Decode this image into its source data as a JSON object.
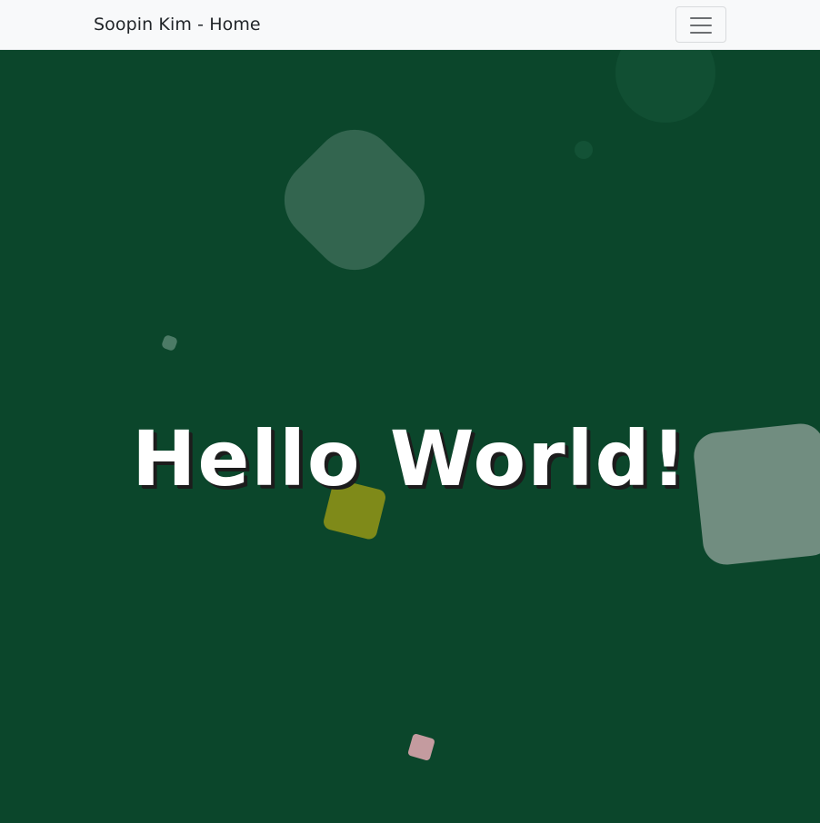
{
  "navbar": {
    "brand": "Soopin Kim - Home",
    "toggler_icon": "hamburger-menu-icon"
  },
  "hero": {
    "headline": "Hello World!",
    "background_color": "#0b462b",
    "shape_colors": {
      "large_blob": "#33654f",
      "right_square": "#718d80",
      "olive_square": "#7f8a19",
      "pink_square": "#c49b9f",
      "faint_circle": "#114f33"
    }
  }
}
